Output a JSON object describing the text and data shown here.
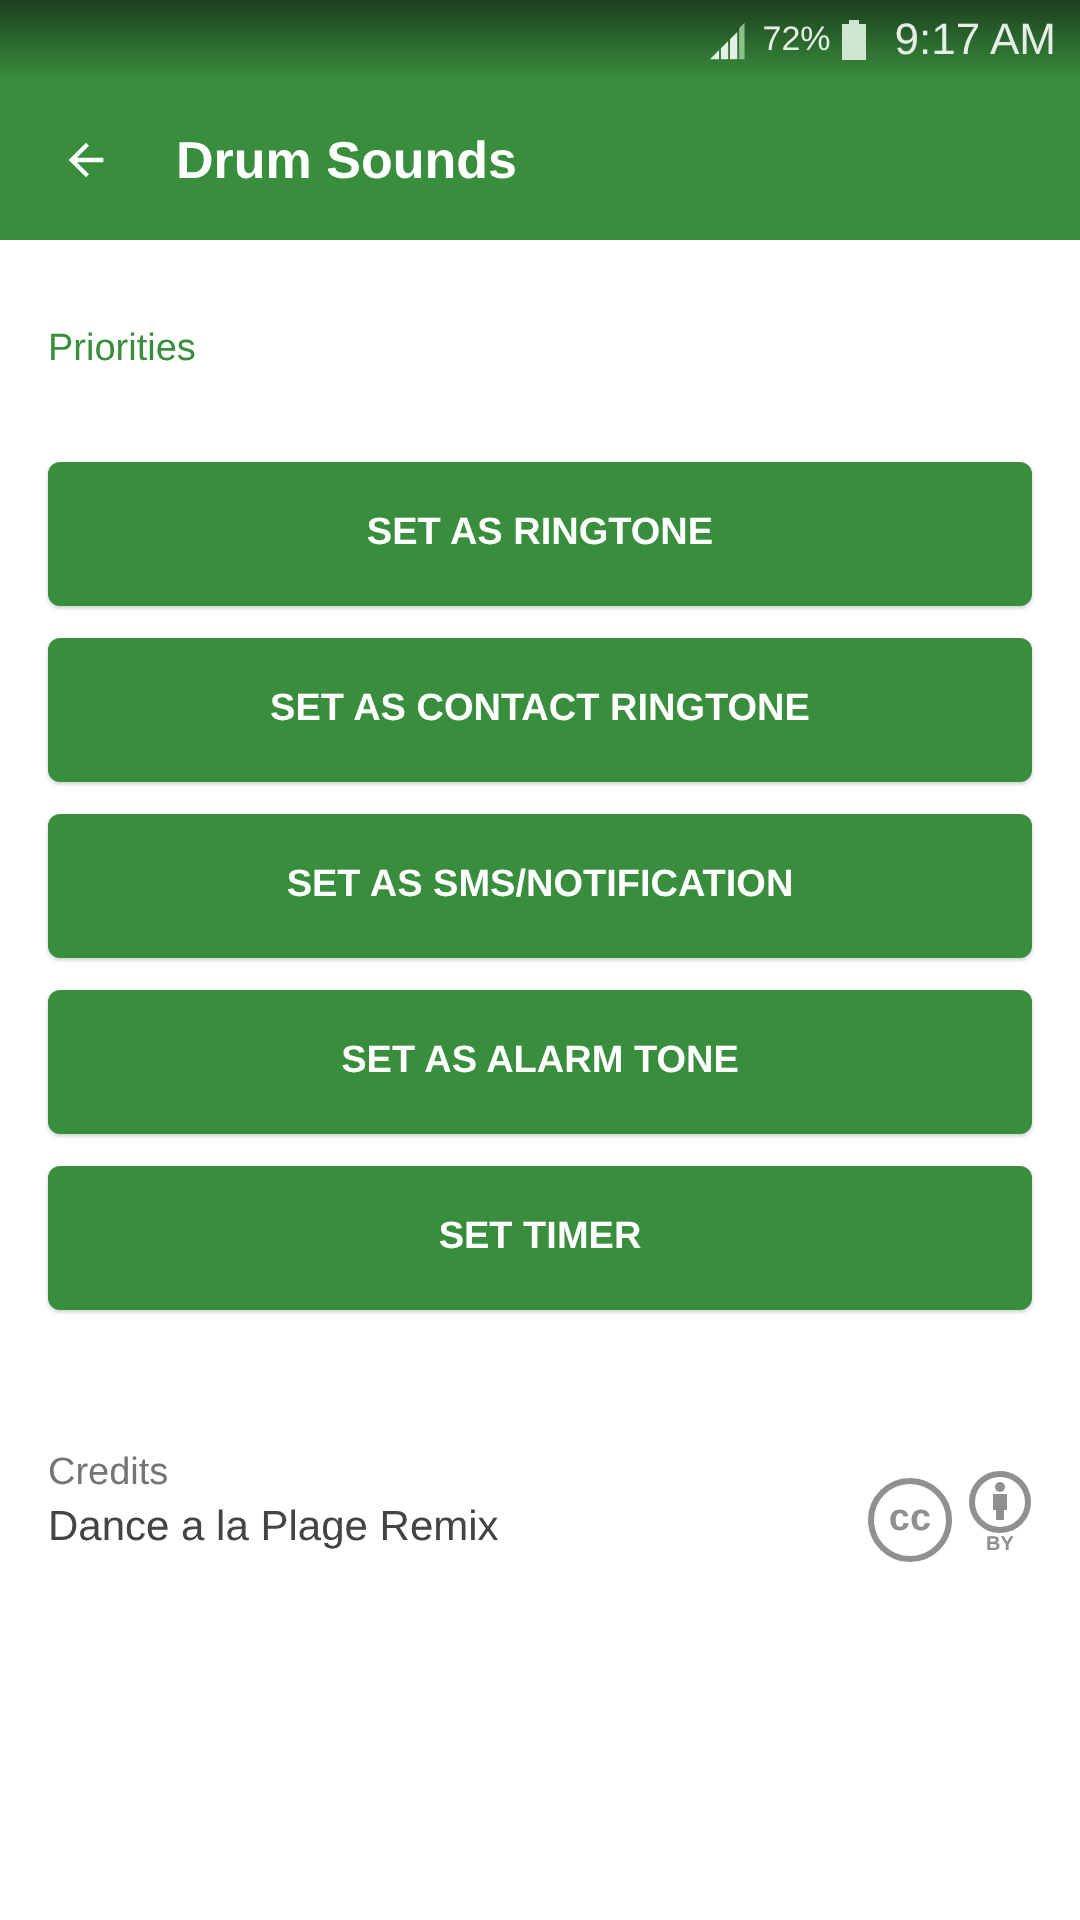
{
  "status_bar": {
    "battery": "72%",
    "time": "9:17 AM"
  },
  "app_bar": {
    "title": "Drum Sounds"
  },
  "section_title": "Priorities",
  "buttons": [
    {
      "label": "SET AS RINGTONE"
    },
    {
      "label": "SET AS CONTACT RINGTONE"
    },
    {
      "label": "SET AS SMS/NOTIFICATION"
    },
    {
      "label": "SET AS ALARM TONE"
    },
    {
      "label": "SET TIMER"
    }
  ],
  "credits": {
    "heading": "Credits",
    "text": "Dance a la Plage Remix",
    "license": {
      "cc_mark": "cc",
      "by_mark": "BY"
    }
  }
}
